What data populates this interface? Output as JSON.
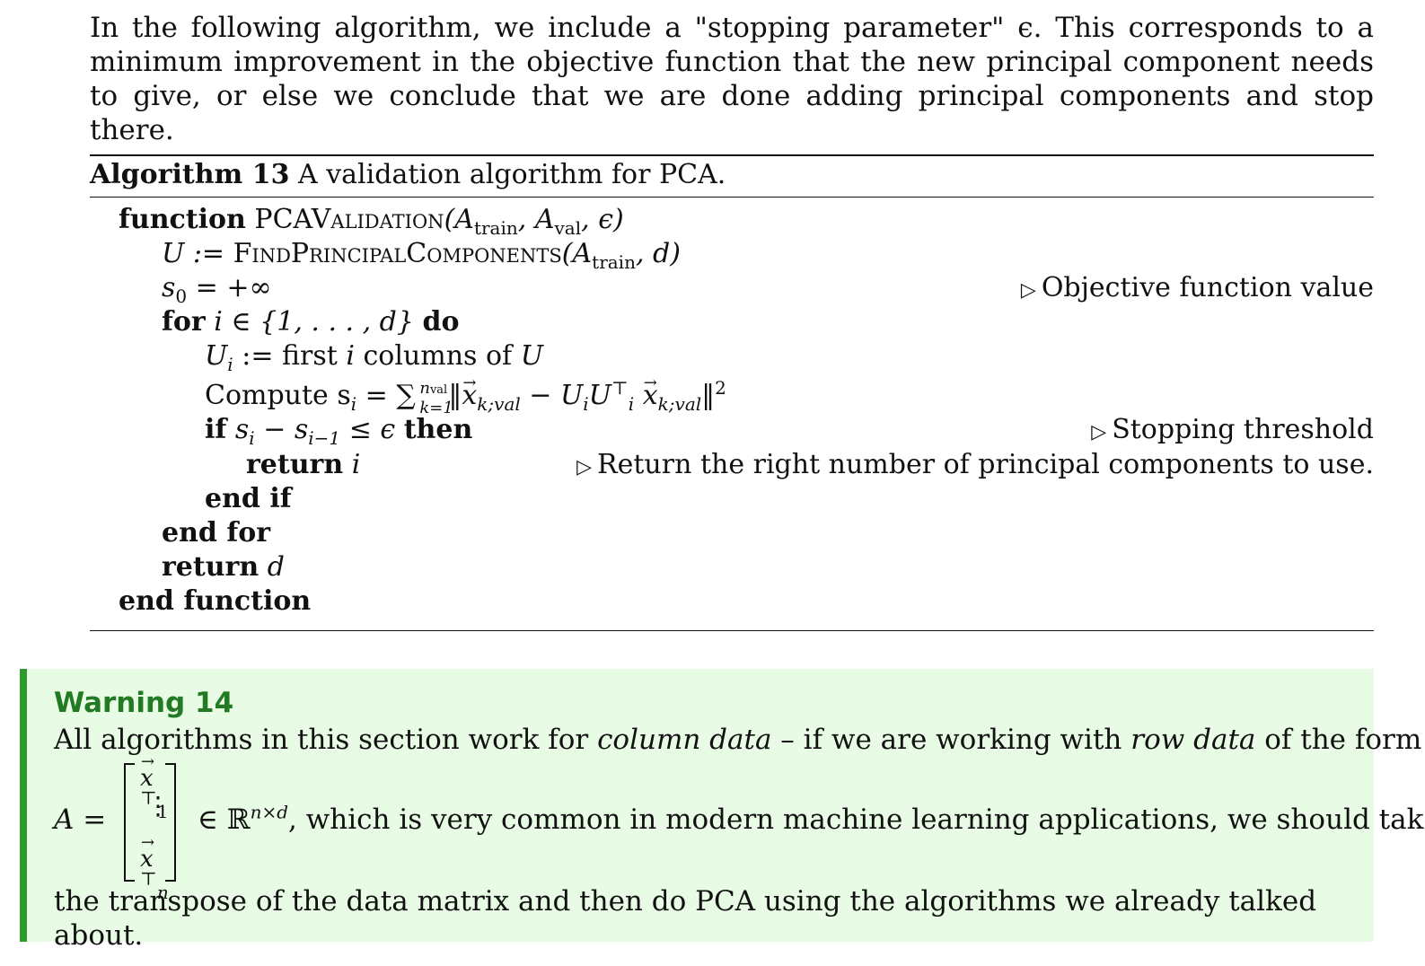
{
  "intro_text": "In the following algorithm, we include a \"stopping parameter\" ϵ. This corresponds to a minimum improvement in the objective function that the new principal component needs to give, or else we conclude that we are done adding principal components and stop there.",
  "algorithm": {
    "label": "Algorithm 13",
    "caption": "A validation algorithm for PCA.",
    "kw_function": "function",
    "func_name": "PCAValidation",
    "func_args": "(A",
    "arg_train": "train",
    "arg_sep": ", A",
    "arg_val": "val",
    "arg_end": ", ϵ)",
    "line2_lhs": "U := ",
    "line2_func": "FindPrincipalComponents",
    "line2_args": "(A",
    "line2_sub": "train",
    "line2_end": ", d)",
    "line3": "s",
    "line3_sub": "0",
    "line3_rhs": " = +∞",
    "comment1": "Objective function value",
    "kw_for": "for",
    "for_cond": " i ∈ {1, . . . , d} ",
    "kw_do": "do",
    "line5_a": "U",
    "line5_sub": "i",
    "line5_b": " := first ",
    "line5_i": "i",
    "line5_c": " columns of ",
    "line5_u": "U",
    "line6_compute": "Compute s",
    "line6_sub": "i",
    "line6_eq": " = ",
    "sum_sym": "∑",
    "sum_up": "n",
    "sum_up_sub": "val",
    "sum_dn": "k=1",
    "norm_open": "‖",
    "x_sub1": "k;val",
    "minus": " − U",
    "u_sub": "i",
    "u2": "U",
    "u2_sup": "⊤",
    "u2_sub": "i",
    "x_sub2": "k;val",
    "norm_close": "‖",
    "norm_sq": "2",
    "kw_if": "if",
    "if_cond_a": " s",
    "if_sub1": "i",
    "if_cond_b": " − s",
    "if_sub2": "i−1",
    "if_cond_c": " ≤ ϵ ",
    "kw_then": "then",
    "comment2": "Stopping threshold",
    "kw_return": "return",
    "return_i": " i",
    "comment3": "Return the right number of principal components to use.",
    "kw_endif": "end if",
    "kw_endfor": "end for",
    "return_d": " d",
    "kw_endfunction": "end function"
  },
  "warning": {
    "title": "Warning 14",
    "line1_a": "All algorithms in this section work for ",
    "line1_em1": "column data",
    "line1_b": " – if we are working with ",
    "line1_em2": "row data",
    "line1_c": " of the form",
    "lhs": "A =",
    "row1": "x",
    "row1_sup": "⊤",
    "row1_sub": "1",
    "dots": "⋮",
    "row3": "x",
    "row3_sup": "⊤",
    "row3_sub": "n",
    "rhs_a": "∈ ℝ",
    "rhs_sup": "n×d",
    "rhs_b": ", which is very common in modern machine learning applications, we should take",
    "line3": "the transpose of the data matrix and then do PCA using the algorithms we already talked about."
  }
}
